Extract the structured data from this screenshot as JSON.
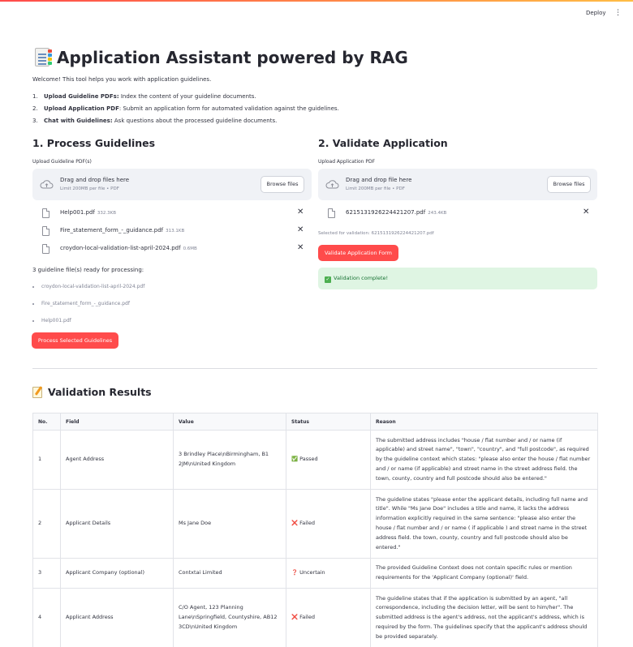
{
  "header": {
    "deploy_label": "Deploy",
    "menu_icon": "kebab-menu-icon"
  },
  "page": {
    "title": "Application Assistant powered by RAG",
    "title_icon": "bookmark-tabs-icon",
    "welcome": "Welcome! This tool helps you work with application guidelines.",
    "steps": [
      {
        "num": "1.",
        "bold": "Upload Guideline PDFs:",
        "text": " Index the content of your guideline documents."
      },
      {
        "num": "2.",
        "bold": "Upload Application PDF",
        "text": ": Submit an application form for automated validation against the guidelines."
      },
      {
        "num": "3.",
        "bold": "Chat with Guidelines:",
        "text": " Ask questions about the processed guideline documents."
      }
    ]
  },
  "guidelines": {
    "heading": "1. Process Guidelines",
    "upload_label": "Upload Guideline PDF(s)",
    "dropzone": {
      "title": "Drag and drop files here",
      "subtitle": "Limit 200MB per file • PDF",
      "browse_label": "Browse files"
    },
    "files": [
      {
        "name": "Help001.pdf",
        "size": "332.3KB"
      },
      {
        "name": "Fire_statement_form_-_guidance.pdf",
        "size": "313.1KB"
      },
      {
        "name": "croydon-local-validation-list-april-2024.pdf",
        "size": "0.6MB"
      }
    ],
    "ready_text": "3 guideline file(s) ready for processing:",
    "ready_list": [
      "croydon-local-validation-list-april-2024.pdf",
      "Fire_statement_form_-_guidance.pdf",
      "Help001.pdf"
    ],
    "process_button": "Process Selected Guidelines"
  },
  "validation": {
    "heading": "2. Validate Application",
    "upload_label": "Upload Application PDF",
    "dropzone": {
      "title": "Drag and drop file here",
      "subtitle": "Limit 200MB per file • PDF",
      "browse_label": "Browse files"
    },
    "file": {
      "name": "6215131926224421207.pdf",
      "size": "243.4KB"
    },
    "selected_text": "Selected for validation: 6215131926224421207.pdf",
    "validate_button": "Validate Application Form",
    "success_text": "Validation complete!"
  },
  "results": {
    "heading": "Validation Results",
    "heading_icon": "memo-icon",
    "columns": [
      "No.",
      "Field",
      "Value",
      "Status",
      "Reason"
    ],
    "rows": [
      {
        "no": "1",
        "field": "Agent Address",
        "value": "3 Brindley Place\\nBirmingham, B1 2JM\\nUnited Kingdom",
        "status_icon": "✅",
        "status": "Passed",
        "reason": "The submitted address includes \"house / flat number and / or name (if applicable) and street name\", \"town\", \"country\", and \"full postcode\", as required by the guideline context which states: \"please also enter the house / flat number and / or name (if applicable) and street name in the street address field. the town, county, country and full postcode should also be entered.\""
      },
      {
        "no": "2",
        "field": "Applicant Details",
        "value": "Ms Jane Doe",
        "status_icon": "❌",
        "status": "Failed",
        "reason": "The guideline states \"please enter the applicant details, including full name and title\". While \"Ms Jane Doe\" includes a title and name, it lacks the address information explicitly required in the same sentence: \"please also enter the house / flat number and / or name ( if applicable ) and street name in the street address field. the town, county, country and full postcode should also be entered.\""
      },
      {
        "no": "3",
        "field": "Applicant Company (optional)",
        "value": "Contxtai Limited",
        "status_icon": "❓",
        "status": "Uncertain",
        "reason": "The provided Guideline Context does not contain specific rules or mention requirements for the 'Applicant Company (optional)' field."
      },
      {
        "no": "4",
        "field": "Applicant Address",
        "value": "C/O Agent, 123 Planning Lane\\nSpringfield, Countyshire, AB12 3CD\\nUnited Kingdom",
        "status_icon": "❌",
        "status": "Failed",
        "reason": "The guideline states that if the application is submitted by an agent, \"all correspondence, including the decision letter, will be sent to him/her\". The submitted address is the agent's address, not the applicant's address, which is required by the form. The guidelines specify that the applicant's address should be provided separately."
      }
    ]
  },
  "colors": {
    "primary": "#ff4b4b",
    "success_bg": "#dff5e3",
    "success_text": "#177233",
    "dropzone_bg": "#f0f2f6"
  }
}
